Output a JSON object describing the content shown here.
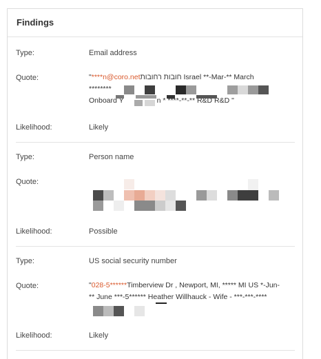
{
  "panel": {
    "title": "Findings"
  },
  "labels": {
    "type": "Type:",
    "quote": "Quote:",
    "likelihood": "Likelihood:"
  },
  "findings": [
    {
      "type": "Email address",
      "quote_highlight": "****n@coro.net",
      "quote_line1_rest": "חובות רחובות Israel **-Mar-** March",
      "quote_line2": "********",
      "quote_line3a": "Onboard Y",
      "quote_line3b": "n * ****-**-** R&D R&D \"",
      "likelihood": "Likely"
    },
    {
      "type": "Person name",
      "likelihood": "Possible"
    },
    {
      "type": "US social security number",
      "quote_highlight": "028-5******",
      "quote_line1_rest": "Timberview Dr , Newport, MI, ***** MI US *-Jun-",
      "quote_line2": "** June ***-5****** Heather Willhauck - Wife - ***-***-****",
      "likelihood": "Likely"
    }
  ],
  "colors": {
    "highlight": "#d9582b",
    "divider": "#e3e3e3",
    "border": "#dcdcdc"
  }
}
